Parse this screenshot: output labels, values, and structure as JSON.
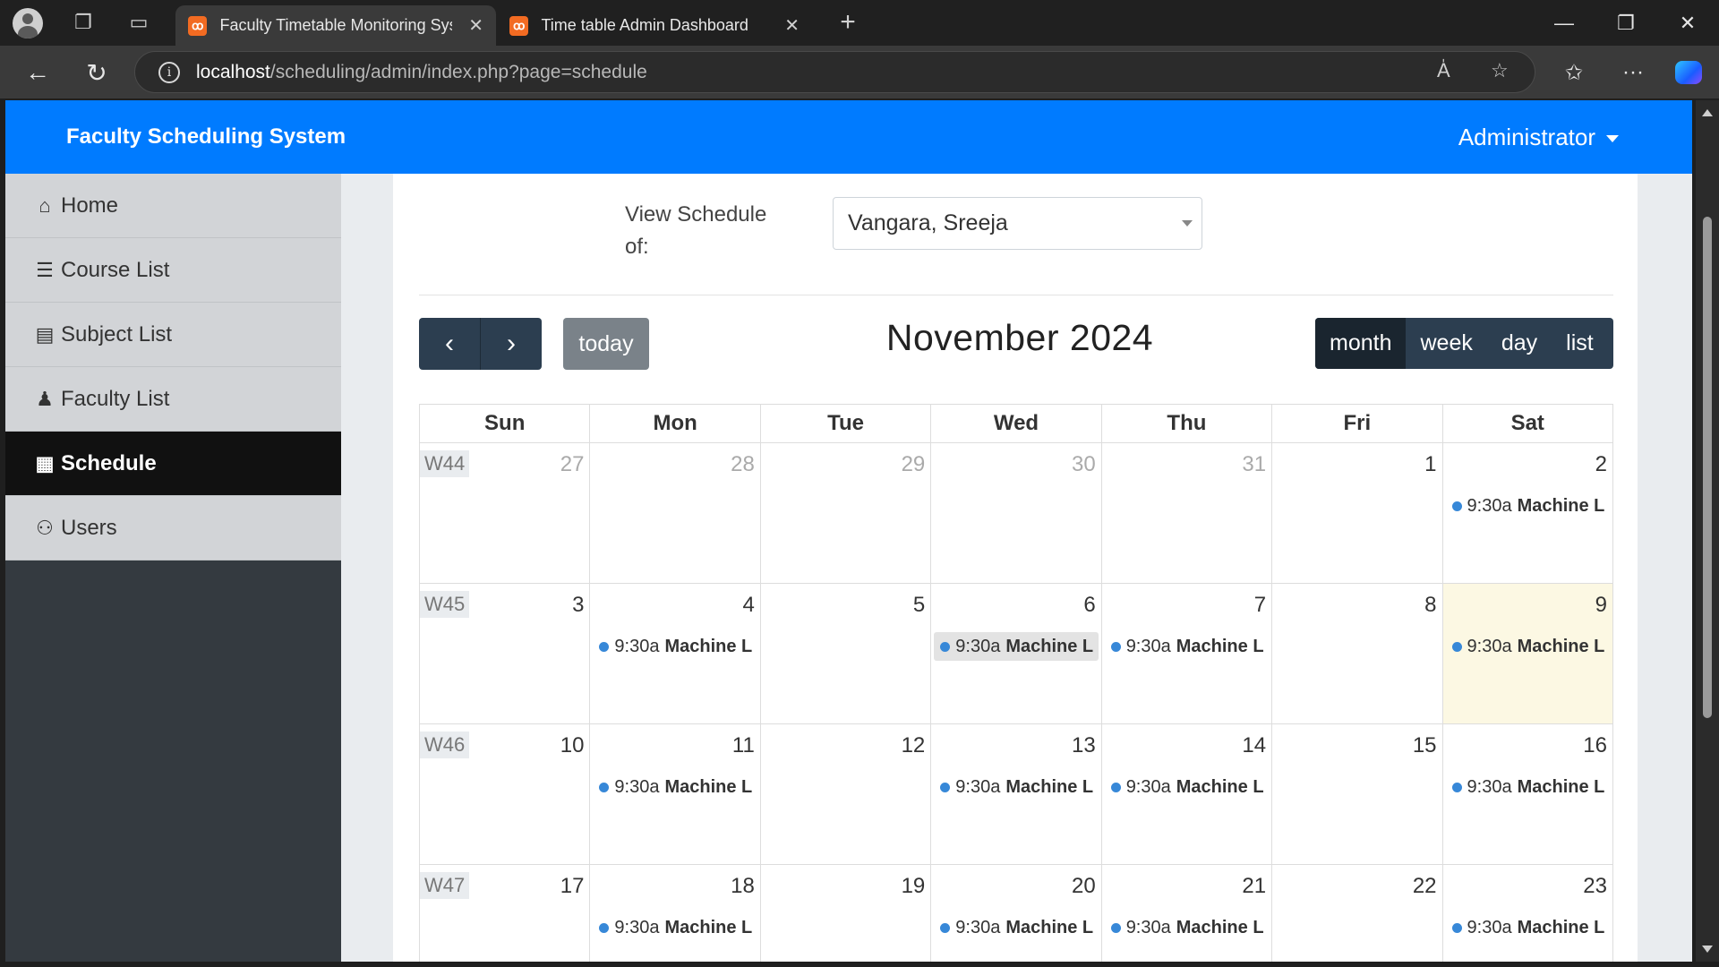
{
  "browser": {
    "tabs": [
      {
        "title": "Faculty Timetable Monitoring Syst",
        "active": true
      },
      {
        "title": "Time table Admin Dashboard",
        "active": false
      }
    ],
    "url_host": "localhost",
    "url_path": "/scheduling/admin/index.php?page=schedule"
  },
  "navbar": {
    "brand": "Faculty Scheduling System",
    "user": "Administrator"
  },
  "sidebar": {
    "items": [
      {
        "label": "Home",
        "icon": "home-icon"
      },
      {
        "label": "Course List",
        "icon": "list-icon"
      },
      {
        "label": "Subject List",
        "icon": "book-icon"
      },
      {
        "label": "Faculty List",
        "icon": "user-tie-icon"
      },
      {
        "label": "Schedule",
        "icon": "calendar-icon",
        "active": true
      },
      {
        "label": "Users",
        "icon": "users-icon"
      }
    ]
  },
  "schedule": {
    "view_label": "View Schedule of:",
    "faculty_selected": "Vangara, Sreeja"
  },
  "calendar": {
    "title": "November 2024",
    "today_label": "today",
    "views": [
      "month",
      "week",
      "day",
      "list"
    ],
    "active_view": "month",
    "weekdays": [
      "Sun",
      "Mon",
      "Tue",
      "Wed",
      "Thu",
      "Fri",
      "Sat"
    ],
    "event_time": "9:30a",
    "event_name": "Machine L",
    "weeks": [
      {
        "label": "W44",
        "days": [
          {
            "n": "27",
            "other": true
          },
          {
            "n": "28",
            "other": true
          },
          {
            "n": "29",
            "other": true
          },
          {
            "n": "30",
            "other": true
          },
          {
            "n": "31",
            "other": true
          },
          {
            "n": "1"
          },
          {
            "n": "2",
            "event": true
          }
        ]
      },
      {
        "label": "W45",
        "days": [
          {
            "n": "3"
          },
          {
            "n": "4",
            "event": true
          },
          {
            "n": "5"
          },
          {
            "n": "6",
            "event": true,
            "highlight": true
          },
          {
            "n": "7",
            "event": true
          },
          {
            "n": "8"
          },
          {
            "n": "9",
            "event": true,
            "today": true
          }
        ]
      },
      {
        "label": "W46",
        "days": [
          {
            "n": "10"
          },
          {
            "n": "11",
            "event": true
          },
          {
            "n": "12"
          },
          {
            "n": "13",
            "event": true
          },
          {
            "n": "14",
            "event": true
          },
          {
            "n": "15"
          },
          {
            "n": "16",
            "event": true
          }
        ]
      },
      {
        "label": "W47",
        "days": [
          {
            "n": "17"
          },
          {
            "n": "18",
            "event": true
          },
          {
            "n": "19"
          },
          {
            "n": "20",
            "event": true
          },
          {
            "n": "21",
            "event": true
          },
          {
            "n": "22"
          },
          {
            "n": "23",
            "event": true
          }
        ]
      }
    ]
  }
}
